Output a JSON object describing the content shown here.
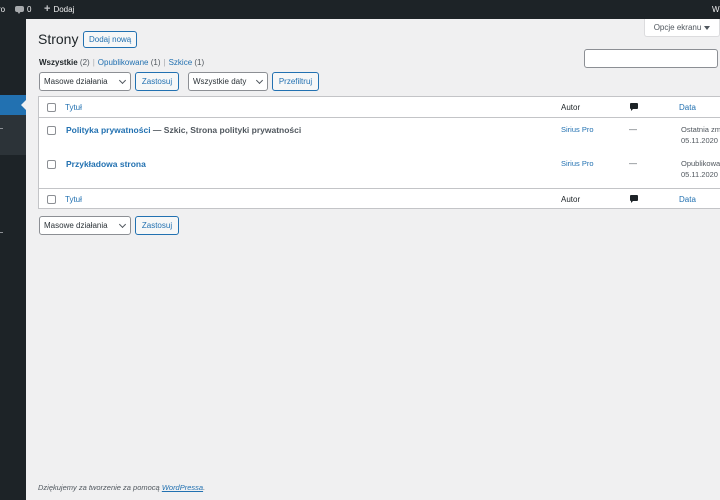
{
  "adminbar": {
    "site_name": "ro",
    "comments_count": "0",
    "new_label": "Dodaj",
    "account_label": "W"
  },
  "screen_options": {
    "label": "Opcje ekranu"
  },
  "header": {
    "title": "Strony",
    "add_new_label": "Dodaj nową"
  },
  "views": [
    {
      "label": "Wszystkie",
      "count": "(2)",
      "current": true
    },
    {
      "label": "Opublikowane",
      "count": "(1)",
      "current": false
    },
    {
      "label": "Szkice",
      "count": "(1)",
      "current": false
    }
  ],
  "search": {
    "placeholder": ""
  },
  "toolbar_top": {
    "bulk_actions": "Masowe działania",
    "apply": "Zastosuj",
    "dates": "Wszystkie daty",
    "filter": "Przefiltruj"
  },
  "table": {
    "columns": {
      "title": "Tytuł",
      "author": "Autor",
      "date": "Data"
    },
    "rows": [
      {
        "title": "Polityka prywatności",
        "state": " — Szkic, Strona polityki prywatności",
        "author": "Sirius Pro",
        "comments": "—",
        "date_status": "Ostatnia zm",
        "date": "05.11.2020"
      },
      {
        "title": "Przykładowa strona",
        "state": "",
        "author": "Sirius Pro",
        "comments": "—",
        "date_status": "Opublikowa",
        "date": "05.11.2020"
      }
    ]
  },
  "toolbar_bottom": {
    "bulk_actions": "Masowe działania",
    "apply": "Zastosuj"
  },
  "footer": {
    "text": "Dziękujemy za tworzenie za pomocą ",
    "link": "WordPressa",
    "end": "."
  },
  "colors": {
    "admin_dark": "#1d2327",
    "accent": "#2271b1",
    "background": "#f0f0f1"
  }
}
